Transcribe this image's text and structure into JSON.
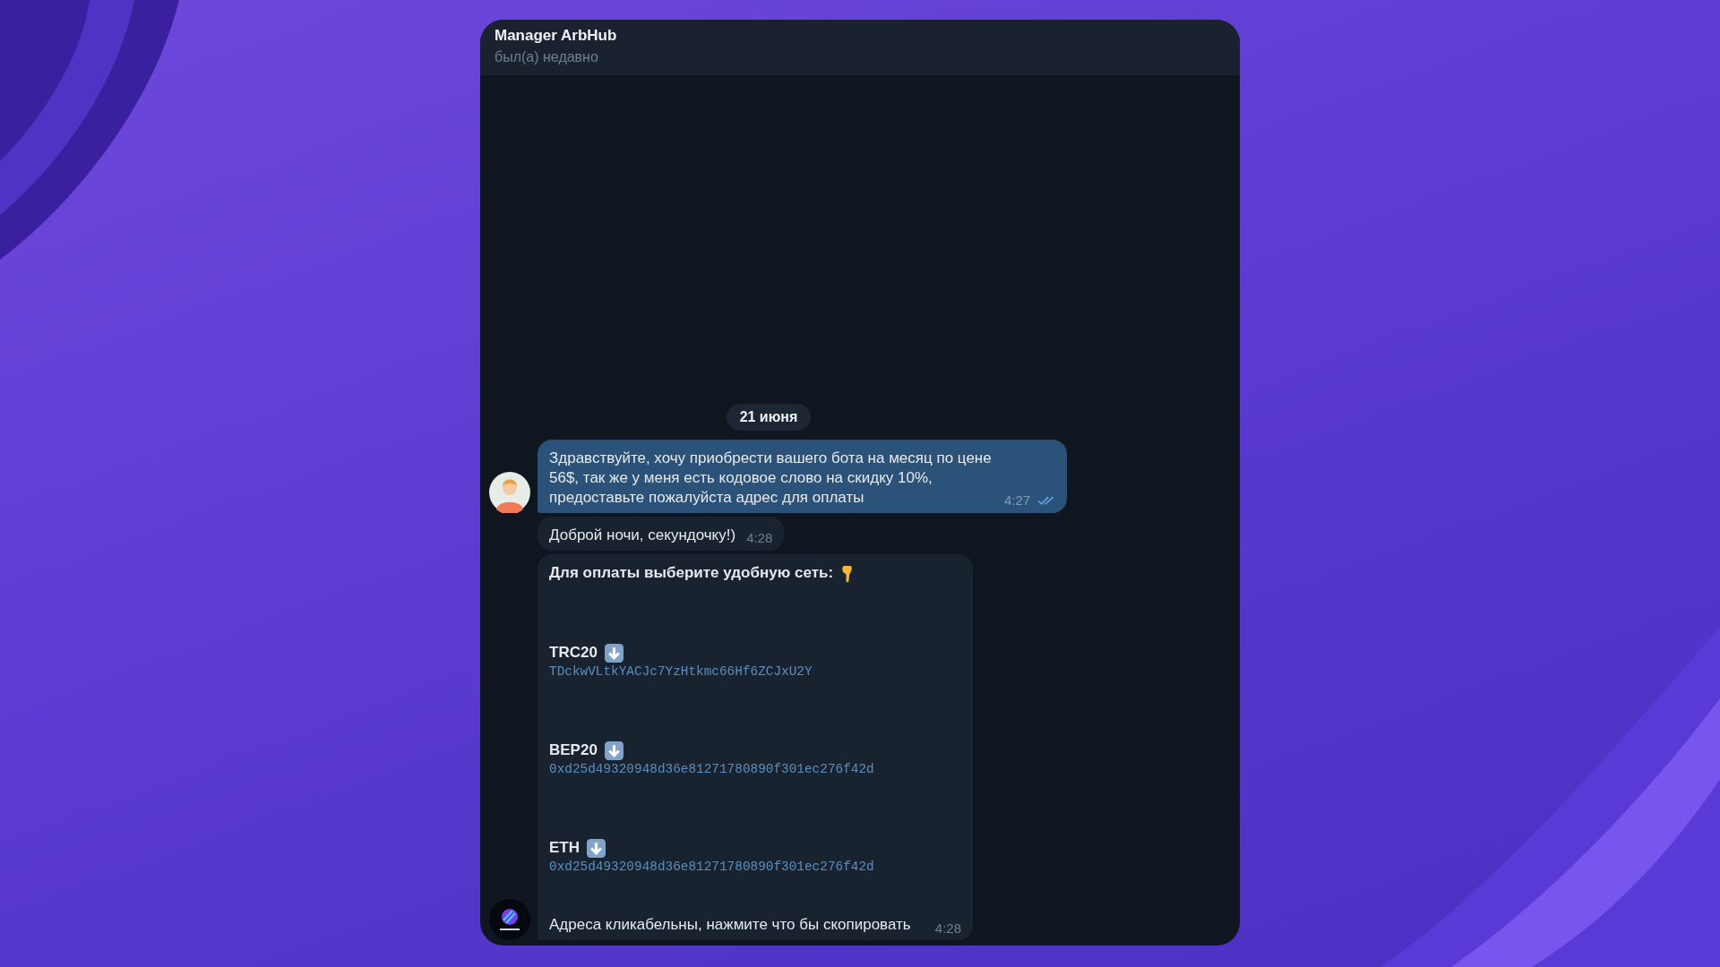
{
  "header": {
    "title": "Manager ArbHub",
    "status": "был(а) недавно"
  },
  "date_separator": "21 июня",
  "messages": [
    {
      "kind": "text",
      "outgoing": true,
      "read": true,
      "avatar": true,
      "text": "Здравствуйте, хочу приобрести вашего бота на месяц по цене 56$, так же у меня есть кодовое слово на скидку 10%, предоставьте пожалуйста адрес для оплаты",
      "time": "4:27"
    },
    {
      "kind": "text",
      "outgoing": false,
      "avatar": false,
      "text": "Доброй ночи, секундочку!)",
      "time": "4:28"
    },
    {
      "kind": "payment",
      "outgoing": false,
      "avatar": true,
      "title": "Для оплаты выберите удобную сеть:",
      "networks": [
        {
          "name": "TRC20",
          "address": "TDckwVLtkYACJc7YzHtkmc66Hf6ZCJxU2Y"
        },
        {
          "name": "BEP20",
          "address": "0xd25d49320948d36e81271780890f301ec276f42d"
        },
        {
          "name": "ETH",
          "address": "0xd25d49320948d36e81271780890f301ec276f42d"
        }
      ],
      "text": "Адреса кликабельны, нажмите что бы скопировать",
      "time": "4:28"
    }
  ]
}
